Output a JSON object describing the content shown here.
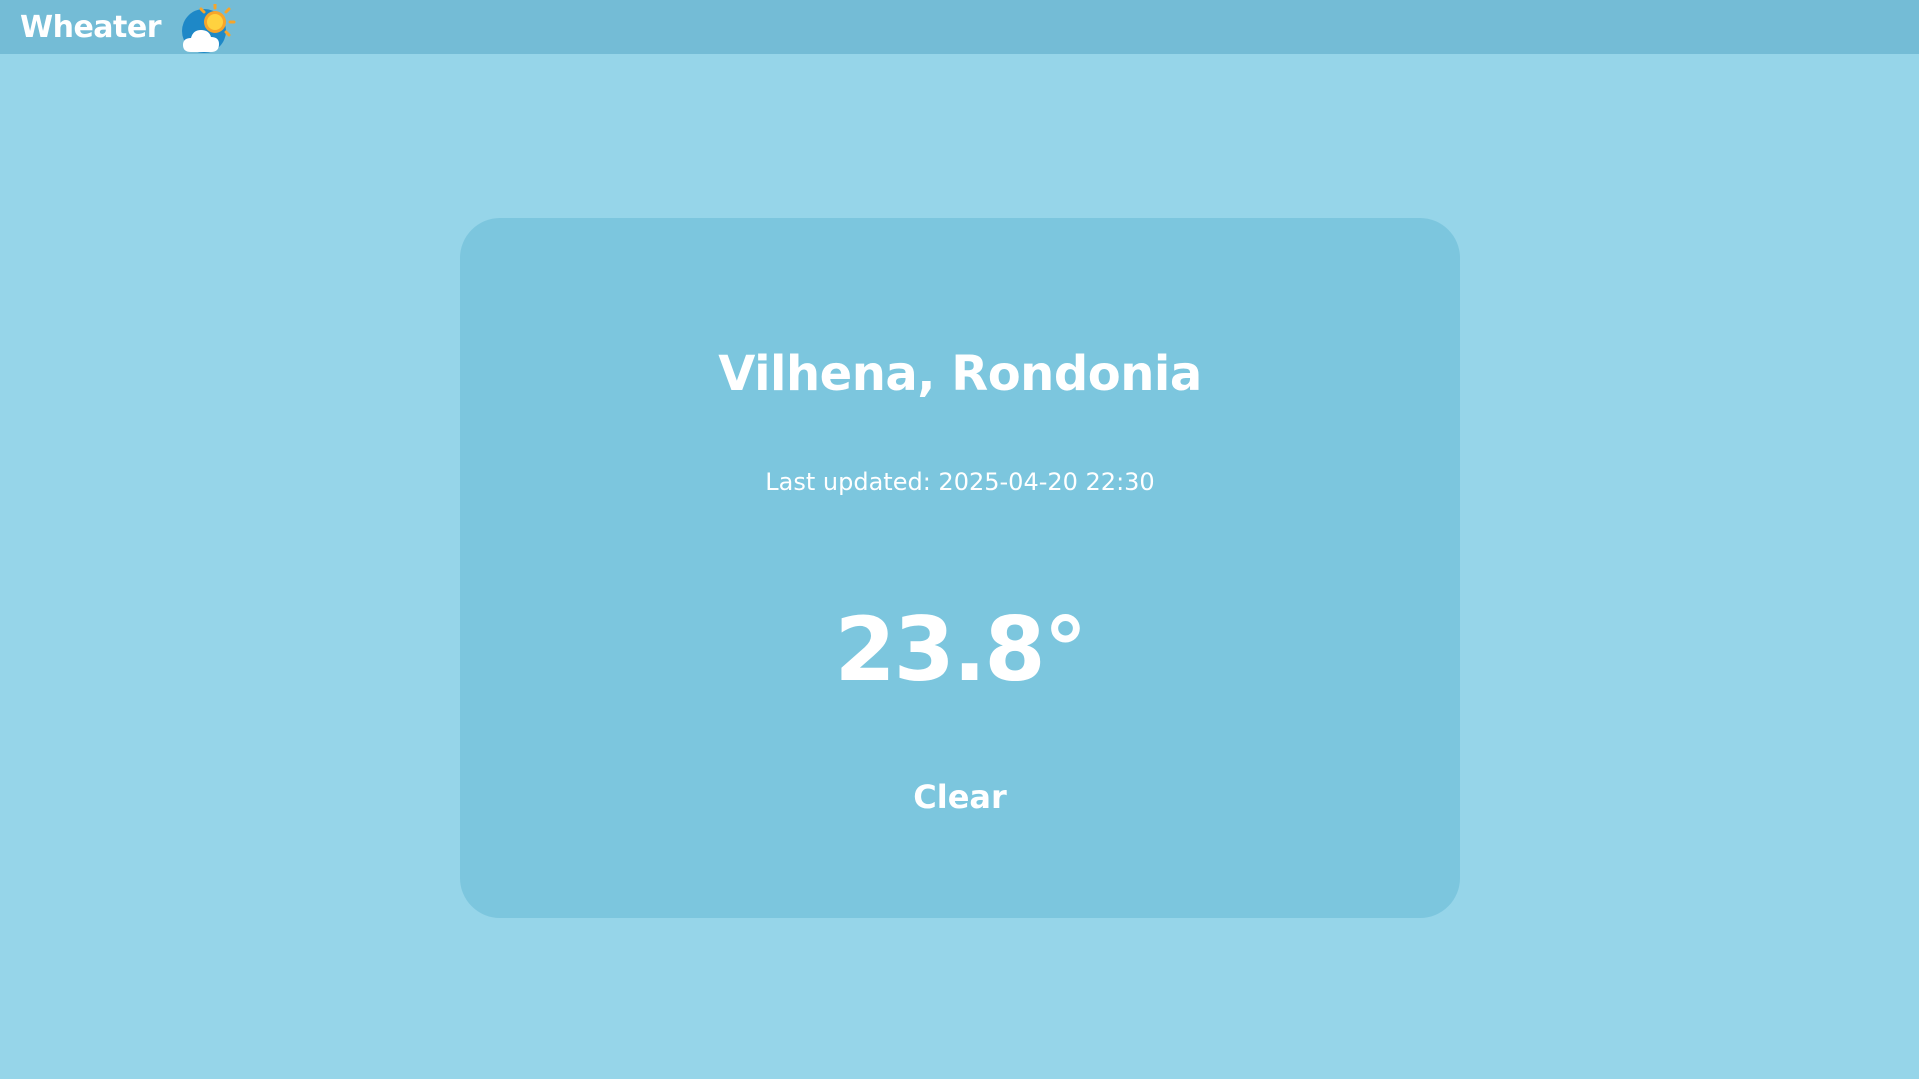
{
  "header": {
    "brand": "Wheater",
    "logo_icon": "partly-cloudy-icon"
  },
  "weather": {
    "location": "Vilhena, Rondonia",
    "last_updated": "Last updated: 2025-04-20 22:30",
    "temperature": "23.8°",
    "condition": "Clear"
  },
  "colors": {
    "background": "#96d5e9",
    "header": "#74bcd6",
    "card": "#7cc6de",
    "text": "#ffffff"
  }
}
